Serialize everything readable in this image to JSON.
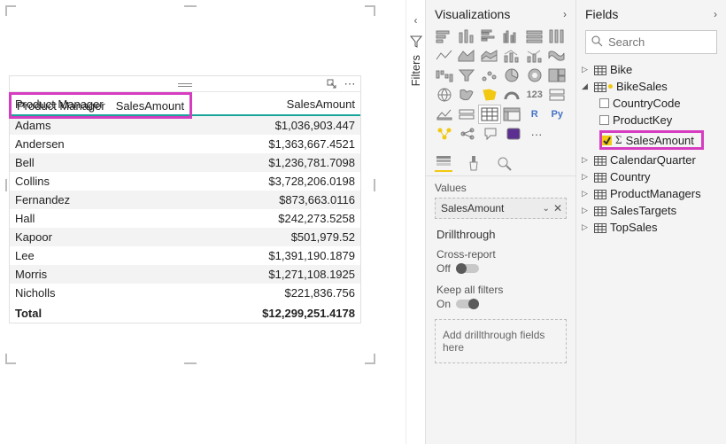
{
  "canvas": {
    "headers": [
      "Product Manager",
      "SalesAmount"
    ],
    "rows": [
      {
        "manager": "Adams",
        "amount": "$1,036,903.447"
      },
      {
        "manager": "Andersen",
        "amount": "$1,363,667.4521"
      },
      {
        "manager": "Bell",
        "amount": "$1,236,781.7098"
      },
      {
        "manager": "Collins",
        "amount": "$3,728,206.0198"
      },
      {
        "manager": "Fernandez",
        "amount": "$873,663.0116"
      },
      {
        "manager": "Hall",
        "amount": "$242,273.5258"
      },
      {
        "manager": "Kapoor",
        "amount": "$501,979.52"
      },
      {
        "manager": "Lee",
        "amount": "$1,391,190.1879"
      },
      {
        "manager": "Morris",
        "amount": "$1,271,108.1925"
      },
      {
        "manager": "Nicholls",
        "amount": "$221,836.756"
      }
    ],
    "total_label": "Total",
    "total_value": "$12,299,251.4178"
  },
  "filters": {
    "label": "Filters"
  },
  "visualizations": {
    "title": "Visualizations",
    "values_label": "Values",
    "well_field": "SalesAmount",
    "drillthrough_label": "Drillthrough",
    "cross_report_label": "Cross-report",
    "cross_report_state": "Off",
    "keep_filters_label": "Keep all filters",
    "keep_filters_state": "On",
    "dropzone": "Add drillthrough fields here"
  },
  "fields": {
    "title": "Fields",
    "search_placeholder": "Search",
    "tables": [
      {
        "name": "Bike",
        "expanded": false
      },
      {
        "name": "BikeSales",
        "expanded": true,
        "children": [
          {
            "name": "CountryCode",
            "checked": false
          },
          {
            "name": "ProductKey",
            "checked": false
          },
          {
            "name": "SalesAmount",
            "checked": true,
            "sigma": true,
            "highlight": true
          }
        ]
      },
      {
        "name": "CalendarQuarter",
        "expanded": false
      },
      {
        "name": "Country",
        "expanded": false
      },
      {
        "name": "ProductManagers",
        "expanded": false
      },
      {
        "name": "SalesTargets",
        "expanded": false
      },
      {
        "name": "TopSales",
        "expanded": false
      }
    ]
  }
}
